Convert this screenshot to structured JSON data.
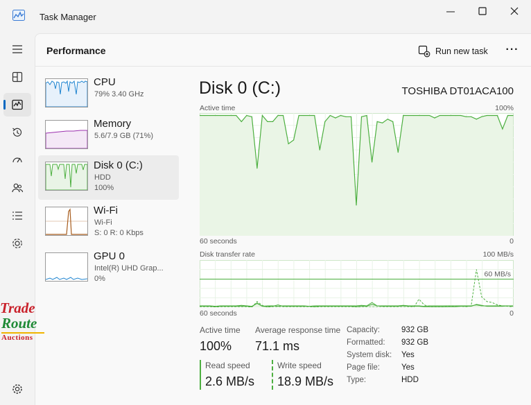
{
  "window": {
    "title": "Task Manager"
  },
  "header": {
    "page_title": "Performance",
    "run_new_task": "Run new task",
    "more": "···"
  },
  "nav": [
    {
      "name": "nav-hamburger-icon"
    },
    {
      "name": "processes-icon"
    },
    {
      "name": "performance-icon",
      "active": true
    },
    {
      "name": "app-history-icon"
    },
    {
      "name": "startup-apps-icon"
    },
    {
      "name": "users-icon"
    },
    {
      "name": "details-icon"
    },
    {
      "name": "services-icon"
    },
    {
      "name": "settings-icon"
    }
  ],
  "devices": [
    {
      "name": "CPU",
      "sub1": "79% 3.40 GHz",
      "sub2": "",
      "color": "#1f84d0"
    },
    {
      "name": "Memory",
      "sub1": "5.6/7.9 GB (71%)",
      "sub2": "",
      "color": "#9b2fae"
    },
    {
      "name": "Disk 0 (C:)",
      "sub1": "HDD",
      "sub2": "100%",
      "color": "#4caf3f",
      "selected": true
    },
    {
      "name": "Wi-Fi",
      "sub1": "Wi-Fi",
      "sub2": "S: 0 R: 0 Kbps",
      "color": "#a75c1d"
    },
    {
      "name": "GPU 0",
      "sub1": "Intel(R) UHD Grap...",
      "sub2": "0%",
      "color": "#1f84d0"
    }
  ],
  "detail": {
    "title": "Disk 0 (C:)",
    "model": "TOSHIBA DT01ACA100",
    "active_graph": {
      "label": "Active time",
      "max": "100%",
      "xleft": "60 seconds",
      "xright": "0"
    },
    "transfer_graph": {
      "label": "Disk transfer rate",
      "max": "100 MB/s",
      "ref": "60 MB/s",
      "xleft": "60 seconds",
      "xright": "0"
    },
    "stats": {
      "active_time_label": "Active time",
      "active_time": "100%",
      "response_label": "Average response time",
      "response": "71.1 ms",
      "read_label": "Read speed",
      "read": "2.6 MB/s",
      "write_label": "Write speed",
      "write": "18.9 MB/s"
    },
    "properties": [
      {
        "label": "Capacity:",
        "value": "932 GB"
      },
      {
        "label": "Formatted:",
        "value": "932 GB"
      },
      {
        "label": "System disk:",
        "value": "Yes"
      },
      {
        "label": "Page file:",
        "value": "Yes"
      },
      {
        "label": "Type:",
        "value": "HDD"
      }
    ]
  },
  "watermark": {
    "line1": "Trade",
    "line2": "Route",
    "line3": "Auctions"
  },
  "chart_data": [
    {
      "type": "area",
      "title": "Active time",
      "ylim": [
        0,
        100
      ],
      "xlim": [
        60,
        0
      ],
      "series": [
        {
          "values": [
            98,
            98,
            98,
            98,
            98,
            98,
            98,
            98,
            93,
            98,
            97,
            55,
            98,
            93,
            93,
            98,
            98,
            75,
            78,
            98,
            98,
            98,
            98,
            70,
            93,
            98,
            96,
            98,
            97,
            97,
            25,
            97,
            98,
            60,
            93,
            92,
            95,
            93,
            68,
            98,
            98,
            98,
            98,
            98,
            98,
            96,
            98,
            98,
            98,
            98,
            98,
            97,
            97,
            95,
            97,
            98,
            98,
            98,
            87,
            98,
            98
          ]
        }
      ]
    },
    {
      "type": "line",
      "title": "Disk transfer rate",
      "ylim": [
        0,
        100
      ],
      "xlim": [
        60,
        0
      ],
      "series": [
        {
          "values": [
            3,
            3,
            3,
            2,
            3,
            3,
            3,
            3,
            4,
            3,
            2,
            8,
            2,
            3,
            3,
            2,
            3,
            3,
            3,
            3,
            3,
            2,
            3,
            3,
            3,
            3,
            3,
            3,
            3,
            3,
            3,
            4,
            3,
            10,
            3,
            3,
            3,
            3,
            3,
            4,
            3,
            3,
            3,
            2,
            3,
            3,
            3,
            3,
            3,
            3,
            3,
            3,
            3,
            5,
            3,
            3,
            3,
            3,
            3,
            3,
            3
          ]
        },
        {
          "values": [
            2,
            2,
            2,
            1,
            2,
            2,
            2,
            2,
            2,
            2,
            1,
            9,
            2,
            1,
            2,
            5,
            2,
            2,
            2,
            2,
            2,
            2,
            1,
            2,
            2,
            2,
            2,
            2,
            2,
            2,
            1,
            2,
            2,
            6,
            3,
            2,
            2,
            2,
            2,
            3,
            2,
            2,
            2,
            1,
            1,
            1,
            1,
            1,
            1,
            1,
            2,
            2,
            2,
            6,
            4,
            2,
            2,
            2,
            2,
            3,
            2
          ]
        },
        {
          "values": [
            0,
            0,
            0,
            0,
            0,
            0,
            0,
            0,
            0,
            0,
            0,
            12,
            4,
            0,
            0,
            0,
            0,
            0,
            0,
            0,
            0,
            0,
            0,
            0,
            0,
            0,
            0,
            0,
            0,
            0,
            0,
            0,
            0,
            0,
            0,
            0,
            0,
            0,
            0,
            0,
            0,
            0,
            17,
            5,
            1,
            0,
            0,
            1,
            2,
            2,
            2,
            1,
            3,
            80,
            22,
            12,
            10,
            5,
            3,
            2,
            1
          ]
        }
      ]
    }
  ]
}
